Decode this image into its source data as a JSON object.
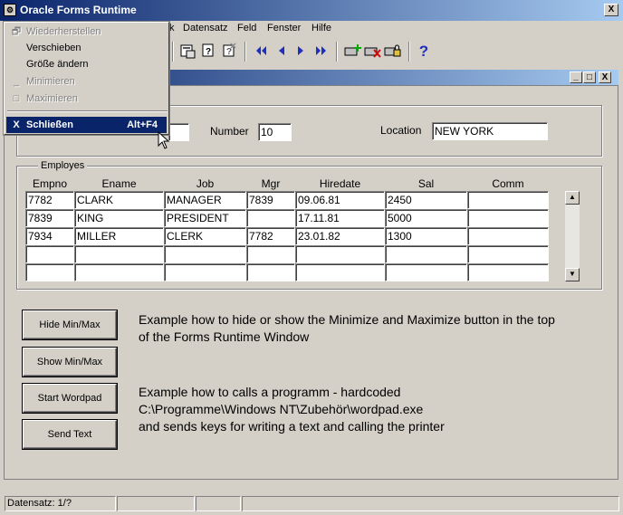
{
  "window": {
    "title": "Oracle Forms Runtime",
    "icon": "oracle-app-icon"
  },
  "title_buttons": {
    "close": "X"
  },
  "inner_window_buttons": {
    "minimize": "_",
    "maximize": "□",
    "close": "X"
  },
  "menubar": {
    "items": [
      "k",
      "Datensatz",
      "Feld",
      "Fenster",
      "Hilfe"
    ]
  },
  "toolbar": {
    "icons": [
      "clear-icon",
      "query-icon",
      "execute-icon",
      "cancel-query-icon",
      "first-record-icon",
      "prev-record-icon",
      "next-record-icon",
      "last-record-icon",
      "insert-record-icon",
      "delete-record-icon",
      "lock-record-icon",
      "help-icon"
    ],
    "help_glyph": "?"
  },
  "system_menu": {
    "items": [
      {
        "label": "Wiederherstellen",
        "disabled": true,
        "icon": "restore-icon"
      },
      {
        "label": "Verschieben",
        "disabled": false
      },
      {
        "label": "Größe ändern",
        "disabled": false
      },
      {
        "label": "Minimieren",
        "disabled": true,
        "icon": "minimize-icon"
      },
      {
        "label": "Maximieren",
        "disabled": true,
        "icon": "maximize-icon"
      }
    ],
    "close": {
      "glyph": "X",
      "label": "Schließen",
      "shortcut": "Alt+F4"
    }
  },
  "dept": {
    "number_label": "Number",
    "number_value": "10",
    "location_label": "Location",
    "location_value": "NEW YORK"
  },
  "employes": {
    "title": "Employes",
    "columns": [
      "Empno",
      "Ename",
      "Job",
      "Mgr",
      "Hiredate",
      "Sal",
      "Comm"
    ],
    "rows": [
      [
        "7782",
        "CLARK",
        "MANAGER",
        "7839",
        "09.06.81",
        "2450",
        ""
      ],
      [
        "7839",
        "KING",
        "PRESIDENT",
        "",
        "17.11.81",
        "5000",
        ""
      ],
      [
        "7934",
        "MILLER",
        "CLERK",
        "7782",
        "23.01.82",
        "1300",
        ""
      ],
      [
        "",
        "",
        "",
        "",
        "",
        "",
        ""
      ],
      [
        "",
        "",
        "",
        "",
        "",
        "",
        ""
      ]
    ]
  },
  "buttons": {
    "hide_minmax": "Hide Min/Max",
    "show_minmax": "Show Min/Max",
    "start_wordpad": "Start Wordpad",
    "send_text": "Send Text"
  },
  "descriptions": {
    "minmax_line1": "Example how to hide or show the Minimize and Maximize button in the top",
    "minmax_line2": "of the Forms Runtime Window",
    "wordpad_line1": "Example how to calls a programm - hardcoded",
    "wordpad_line2": "C:\\Programme\\Windows NT\\Zubehör\\wordpad.exe",
    "wordpad_line3": "and sends keys for writing a text and calling the printer"
  },
  "status": {
    "record": "Datensatz: 1/?"
  },
  "colors": {
    "titlebar_start": "#0a246a",
    "titlebar_end": "#a6caf0",
    "face": "#d4d0c8",
    "nav_arrow": "#1e2fbf"
  }
}
